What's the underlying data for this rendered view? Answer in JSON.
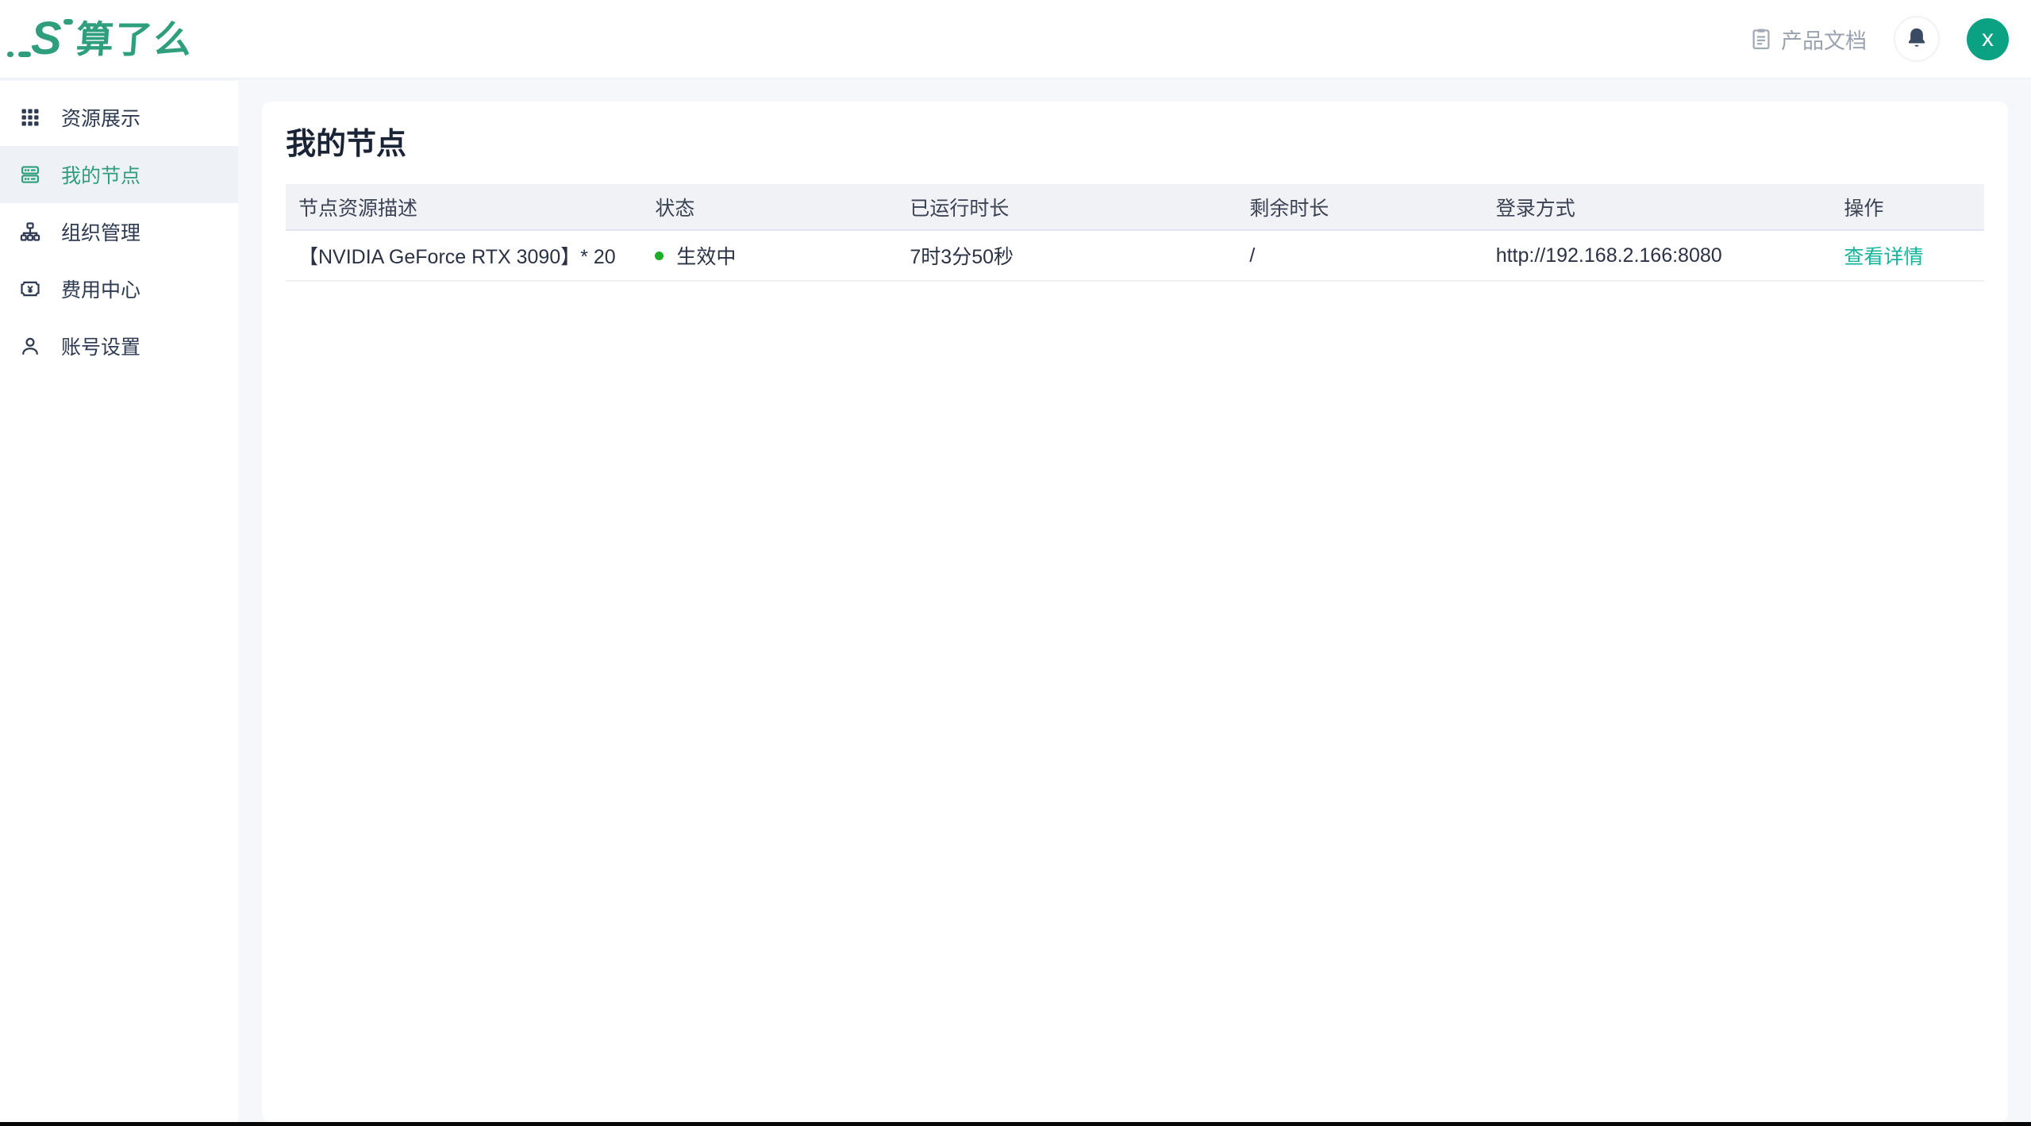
{
  "header": {
    "logo_mark": "S",
    "logo_text": "算了么",
    "docs_label": "产品文档",
    "avatar_text": "x"
  },
  "sidebar": {
    "items": [
      {
        "label": "资源展示",
        "icon": "grid-icon",
        "active": false
      },
      {
        "label": "我的节点",
        "icon": "server-icon",
        "active": true
      },
      {
        "label": "组织管理",
        "icon": "org-chart-icon",
        "active": false
      },
      {
        "label": "费用中心",
        "icon": "billing-icon",
        "active": false
      },
      {
        "label": "账号设置",
        "icon": "account-icon",
        "active": false
      }
    ]
  },
  "main": {
    "title": "我的节点",
    "table": {
      "columns": [
        "节点资源描述",
        "状态",
        "已运行时长",
        "剩余时长",
        "登录方式",
        "操作"
      ],
      "rows": [
        {
          "resource": "【NVIDIA GeForce RTX 3090】* 20",
          "status": "生效中",
          "uptime": "7时3分50秒",
          "remaining": "/",
          "login": "http://192.168.2.166:8080",
          "action": "查看详情"
        }
      ]
    }
  },
  "colors": {
    "brand_green": "#2f9e7c",
    "link_green": "#13b49b",
    "status_dot_green": "#1cae27",
    "avatar_green": "#0ba183",
    "page_background": "#f5f7fa"
  }
}
